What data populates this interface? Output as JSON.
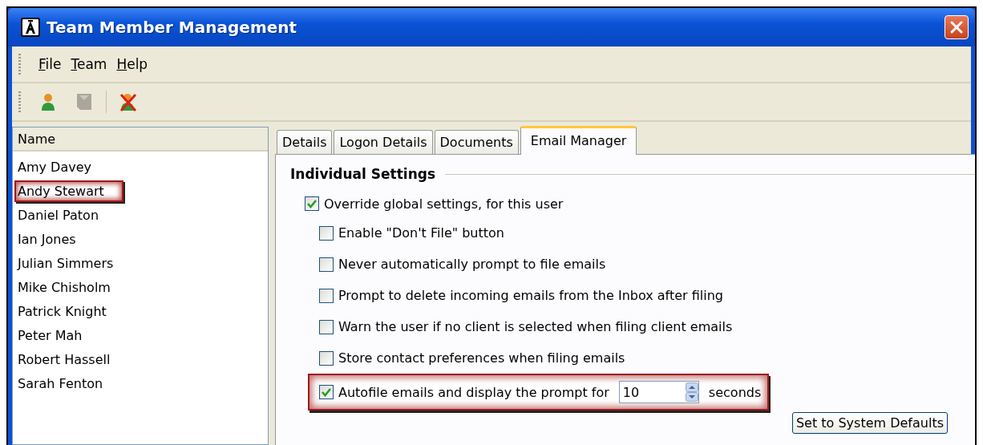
{
  "window": {
    "title": "Team Member Management"
  },
  "menu": [
    "File",
    "Team",
    "Help"
  ],
  "toolbar": [
    {
      "kind": "person",
      "disabled": false
    },
    {
      "kind": "document",
      "disabled": true
    },
    {
      "kind": "person-delete",
      "disabled": false
    }
  ],
  "list": {
    "header": "Name",
    "items": [
      {
        "name": "Amy Davey",
        "highlighted": false
      },
      {
        "name": "Andy Stewart",
        "highlighted": true
      },
      {
        "name": "Daniel Paton",
        "highlighted": false
      },
      {
        "name": "Ian Jones",
        "highlighted": false
      },
      {
        "name": "Julian Simmers",
        "highlighted": false
      },
      {
        "name": "Mike Chisholm",
        "highlighted": false
      },
      {
        "name": "Patrick Knight",
        "highlighted": false
      },
      {
        "name": "Peter Mah",
        "highlighted": false
      },
      {
        "name": "Robert Hassell",
        "highlighted": false
      },
      {
        "name": "Sarah Fenton",
        "highlighted": false
      }
    ]
  },
  "tabs": [
    {
      "label": "Details",
      "selected": false
    },
    {
      "label": "Logon Details",
      "selected": false
    },
    {
      "label": "Documents",
      "selected": false
    },
    {
      "label": "Email Manager",
      "selected": true
    }
  ],
  "section": {
    "title": "Individual Settings",
    "options": [
      {
        "label": "Override global settings, for this user",
        "checked": true,
        "children": [
          {
            "kind": "checkbox",
            "label": "Enable \"Don't File\" button",
            "checked": false,
            "highlighted": false
          },
          {
            "kind": "checkbox",
            "label": "Never automatically prompt to file emails",
            "checked": false,
            "highlighted": false
          },
          {
            "kind": "checkbox",
            "label": "Prompt to delete incoming emails from the Inbox after filing",
            "checked": false,
            "highlighted": false
          },
          {
            "kind": "checkbox",
            "label": "Warn the user if no client is selected when filing client emails",
            "checked": false,
            "highlighted": false
          },
          {
            "kind": "checkbox",
            "label": "Store contact preferences when filing emails",
            "checked": false,
            "highlighted": false
          },
          {
            "kind": "spin",
            "label": "Autofile emails and display the prompt for",
            "checked": true,
            "highlighted": true,
            "value": "10",
            "suffix": "seconds"
          }
        ]
      }
    ]
  },
  "buttons": [
    "Set to System Defaults"
  ]
}
